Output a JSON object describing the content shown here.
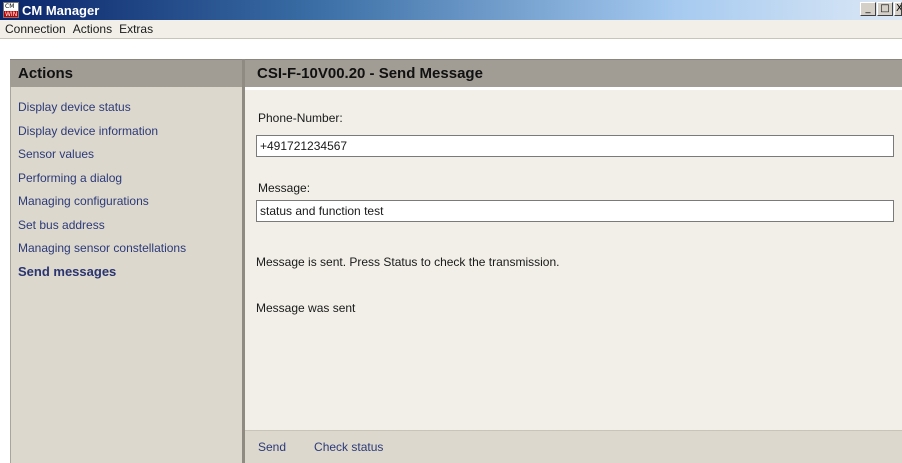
{
  "window": {
    "title": "CM Manager",
    "icon_top_text": "CM",
    "icon_bottom_text": "WIN",
    "minimize_glyph": "_",
    "maximize_glyph": "□",
    "close_glyph": "X"
  },
  "menu": {
    "items": [
      "Connection",
      "Actions",
      "Extras"
    ]
  },
  "sidebar": {
    "title": "Actions",
    "items": [
      {
        "label": "Display device status",
        "active": false
      },
      {
        "label": "Display device information",
        "active": false
      },
      {
        "label": "Sensor values",
        "active": false
      },
      {
        "label": "Performing a dialog",
        "active": false
      },
      {
        "label": "Managing configurations",
        "active": false
      },
      {
        "label": "Set bus address",
        "active": false
      },
      {
        "label": "Managing sensor constellations",
        "active": false
      },
      {
        "label": "Send messages",
        "active": true
      }
    ]
  },
  "main": {
    "title": "CSI-F-10V00.20 - Send Message",
    "phone_label": "Phone-Number:",
    "phone_value": "+491721234567",
    "message_label": "Message:",
    "message_value": "status and function test",
    "info_text": "Message is sent. Press Status to check the transmission.",
    "result_text": "Message was sent"
  },
  "footer": {
    "send_label": "Send",
    "check_status_label": "Check status"
  },
  "colors": {
    "header_gray": "#a19d95",
    "sidebar_bg": "#dcd8ce",
    "panel_bg": "#f1efe7",
    "link_blue": "#2c3a78"
  }
}
